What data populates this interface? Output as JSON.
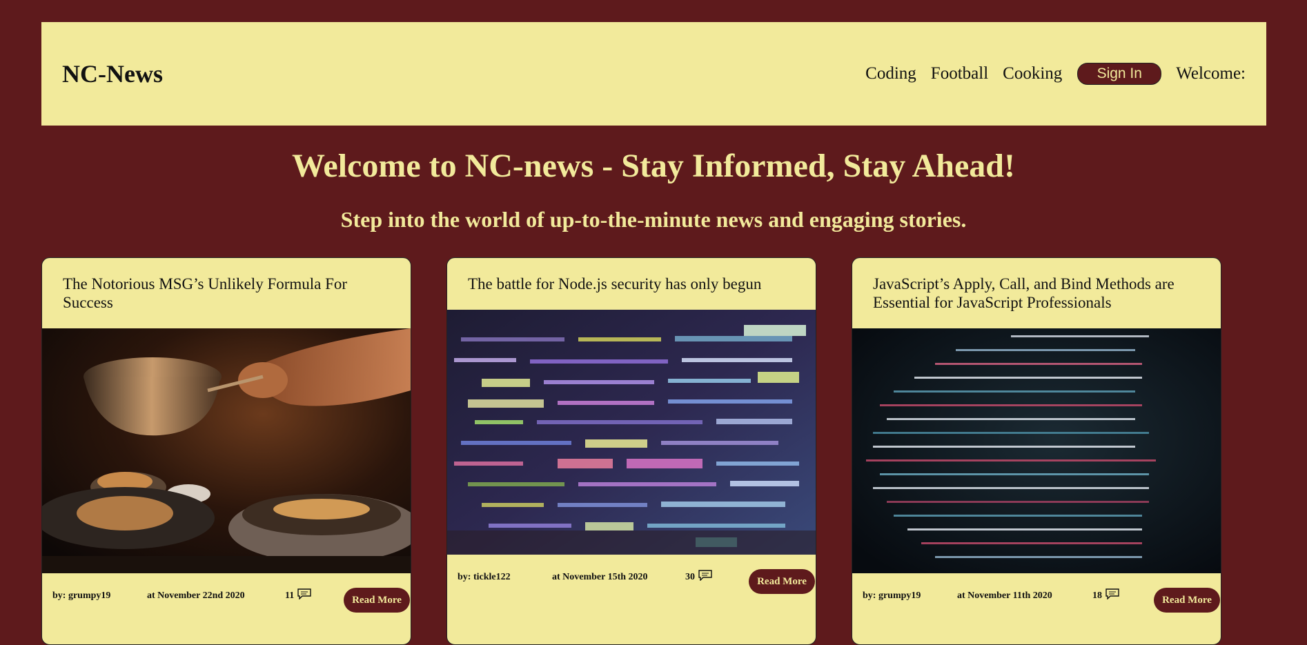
{
  "header": {
    "logo": "NC-News",
    "nav": [
      "Coding",
      "Football",
      "Cooking"
    ],
    "signin_label": "Sign In",
    "welcome_label": "Welcome:"
  },
  "hero": {
    "title": "Welcome to NC-news - Stay Informed, Stay Ahead!",
    "subtitle": "Step into the world of up-to-the-minute news and engaging stories."
  },
  "articles": [
    {
      "title": "The Notorious MSG’s Unlikely Formula For Success",
      "author": "by: grumpy19",
      "date": "at November 22nd 2020",
      "comment_count": "11",
      "read_more": "Read More",
      "image_icon": "cooking-photo"
    },
    {
      "title": "The battle for Node.js security has only begun",
      "author": "by: tickle122",
      "date": "at November 15th 2020",
      "comment_count": "30",
      "read_more": "Read More",
      "image_icon": "code-screen-photo"
    },
    {
      "title": "JavaScript’s Apply, Call, and Bind Methods are Essential for JavaScript Professionals",
      "author": "by: grumpy19",
      "date": "at November 11th 2020",
      "comment_count": "18",
      "read_more": "Read More",
      "image_icon": "code-screen-photo"
    }
  ],
  "colors": {
    "background": "#5e1a1c",
    "panel": "#f2ea9b",
    "text": "#111111"
  }
}
